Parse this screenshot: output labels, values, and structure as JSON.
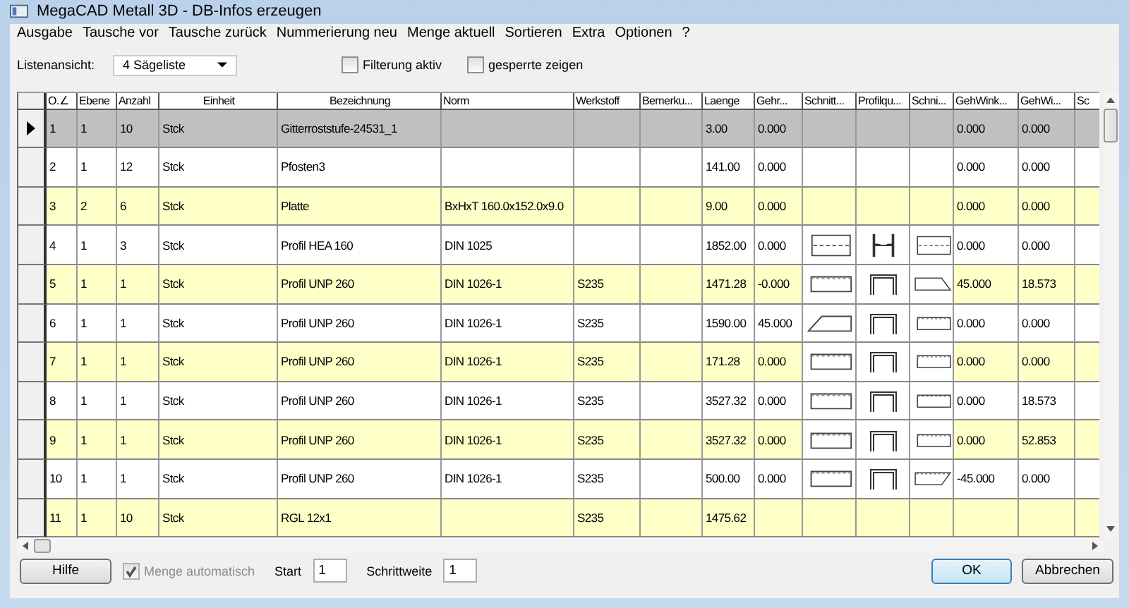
{
  "window": {
    "title": "MegaCAD Metall 3D - DB-Infos erzeugen"
  },
  "menu": [
    "Ausgabe",
    "Tausche vor",
    "Tausche zurück",
    "Nummerierung neu",
    "Menge aktuell",
    "Sortieren",
    "Extra",
    "Optionen",
    "?"
  ],
  "options": {
    "list_view": {
      "label": "Listenansicht:",
      "value": "4 Sägeliste"
    },
    "checkboxes": [
      {
        "label": "Filterung aktiv",
        "checked": false
      },
      {
        "label": "gesperrte zeigen",
        "checked": false
      }
    ]
  },
  "table": {
    "columns": [
      {
        "label": "O.∠",
        "kind": "text"
      },
      {
        "label": "Ebene",
        "kind": "text"
      },
      {
        "label": "Anzahl",
        "kind": "text"
      },
      {
        "label": "Einheit",
        "kind": "text"
      },
      {
        "label": "Bezeichnung",
        "kind": "text"
      },
      {
        "label": "Norm",
        "kind": "text"
      },
      {
        "label": "Werkstoff",
        "kind": "text"
      },
      {
        "label": "Bemerku...",
        "kind": "text"
      },
      {
        "label": "Laenge",
        "kind": "text"
      },
      {
        "label": "Gehr...",
        "kind": "text"
      },
      {
        "label": "Schnitt...",
        "kind": "shape"
      },
      {
        "label": "Profilqu...",
        "kind": "shape"
      },
      {
        "label": "Schni...",
        "kind": "shape"
      },
      {
        "label": "GehWink...",
        "kind": "text"
      },
      {
        "label": "GehWi...",
        "kind": "text"
      },
      {
        "label": "Sc",
        "kind": "text"
      }
    ],
    "rows": [
      {
        "selected": true,
        "highlighted": false,
        "cells": [
          "1",
          "1",
          "10",
          "Stck",
          "Gitterroststufe-24531_1",
          null,
          null,
          null,
          "3.00",
          "0.000",
          null,
          null,
          null,
          "0.000",
          "0.000",
          null
        ]
      },
      {
        "selected": false,
        "highlighted": false,
        "cells": [
          "2",
          "1",
          "12",
          "Stck",
          "Pfosten3",
          null,
          null,
          null,
          "141.00",
          "0.000",
          null,
          null,
          null,
          "0.000",
          "0.000",
          null
        ]
      },
      {
        "selected": false,
        "highlighted": true,
        "cells": [
          "3",
          "2",
          "6",
          "Stck",
          "Platte",
          "BxHxT  160.0x152.0x9.0",
          null,
          null,
          "9.00",
          "0.000",
          null,
          null,
          null,
          "0.000",
          "0.000",
          null
        ]
      },
      {
        "selected": false,
        "highlighted": false,
        "cells": [
          "4",
          "1",
          "3",
          "Stck",
          "Profil HEA 160",
          "DIN 1025",
          null,
          null,
          "1852.00",
          "0.000",
          {
            "kind": "dashed"
          },
          {
            "kind": "h-beam"
          },
          {
            "kind": "dashed"
          },
          "0.000",
          "0.000",
          null
        ]
      },
      {
        "selected": false,
        "highlighted": true,
        "cells": [
          "5",
          "1",
          "1",
          "Stck",
          "Profil UNP 260",
          "DIN 1026-1",
          "S235",
          null,
          "1471.28",
          "-0.000",
          {
            "kind": "plain"
          },
          {
            "kind": "channel"
          },
          {
            "kind": "slant-out"
          },
          "45.000",
          "18.573",
          null
        ]
      },
      {
        "selected": false,
        "highlighted": false,
        "cells": [
          "6",
          "1",
          "1",
          "Stck",
          "Profil UNP 260",
          "DIN 1026-1",
          "S235",
          null,
          "1590.00",
          "45.000",
          {
            "kind": "slant-left"
          },
          {
            "kind": "channel"
          },
          {
            "kind": "plain"
          },
          "0.000",
          "0.000",
          null
        ]
      },
      {
        "selected": false,
        "highlighted": true,
        "cells": [
          "7",
          "1",
          "1",
          "Stck",
          "Profil UNP 260",
          "DIN 1026-1",
          "S235",
          null,
          "171.28",
          "0.000",
          {
            "kind": "plain"
          },
          {
            "kind": "channel"
          },
          {
            "kind": "plain"
          },
          "0.000",
          "0.000",
          null
        ]
      },
      {
        "selected": false,
        "highlighted": false,
        "cells": [
          "8",
          "1",
          "1",
          "Stck",
          "Profil UNP 260",
          "DIN 1026-1",
          "S235",
          null,
          "3527.32",
          "0.000",
          {
            "kind": "plain"
          },
          {
            "kind": "channel"
          },
          {
            "kind": "plain"
          },
          "0.000",
          "18.573",
          null
        ]
      },
      {
        "selected": false,
        "highlighted": true,
        "cells": [
          "9",
          "1",
          "1",
          "Stck",
          "Profil UNP 260",
          "DIN 1026-1",
          "S235",
          null,
          "3527.32",
          "0.000",
          {
            "kind": "plain"
          },
          {
            "kind": "channel"
          },
          {
            "kind": "plain"
          },
          "0.000",
          "52.853",
          null
        ]
      },
      {
        "selected": false,
        "highlighted": false,
        "cells": [
          "10",
          "1",
          "1",
          "Stck",
          "Profil UNP 260",
          "DIN 1026-1",
          "S235",
          null,
          "500.00",
          "0.000",
          {
            "kind": "plain"
          },
          {
            "kind": "channel"
          },
          {
            "kind": "slant-in"
          },
          "-45.000",
          "0.000",
          null
        ]
      },
      {
        "selected": false,
        "highlighted": true,
        "cells": [
          "11",
          "1",
          "10",
          "Stck",
          "RGL 12x1",
          null,
          "S235",
          null,
          "1475.62",
          null,
          null,
          null,
          null,
          null,
          null,
          null
        ]
      }
    ]
  },
  "footer": {
    "help_button": "Hilfe",
    "auto_quantity": {
      "label": "Menge automatisch",
      "checked": true,
      "disabled": true
    },
    "start": {
      "label": "Start",
      "value": "1"
    },
    "step": {
      "label": "Schrittweite",
      "value": "1"
    },
    "buttons": [
      {
        "label": "OK",
        "default": true
      },
      {
        "label": "Abbrechen",
        "default": false
      }
    ]
  }
}
